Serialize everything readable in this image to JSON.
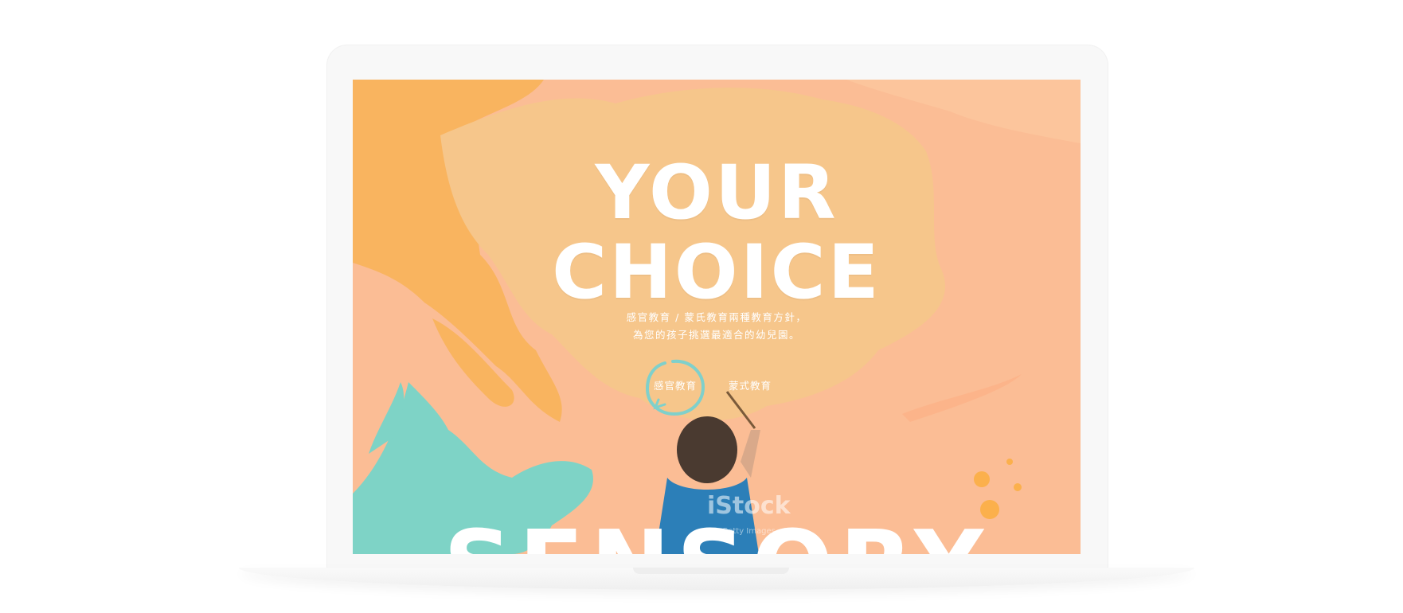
{
  "hero": {
    "title_line1": "YOUR",
    "title_line2": "CHOICE",
    "subtitle_line1": "感官教育 / 蒙氏教育兩種教育方針，",
    "subtitle_line2": "為您的孩子挑選最適合的幼兒園。"
  },
  "choices": {
    "sensory": "感官教育",
    "montessori": "蒙式教育"
  },
  "bottom_word": "SENSORY",
  "watermark": {
    "brand": "iStock",
    "credit": "by Getty Images"
  },
  "colors": {
    "peach_background": "#fbbd95",
    "orange_splash": "#f9b45f",
    "light_orange_splash": "#f6c68b",
    "teal_splash": "#7ed3c6",
    "ring_accent": "#7fd0cb",
    "title_text": "#ffffff"
  }
}
